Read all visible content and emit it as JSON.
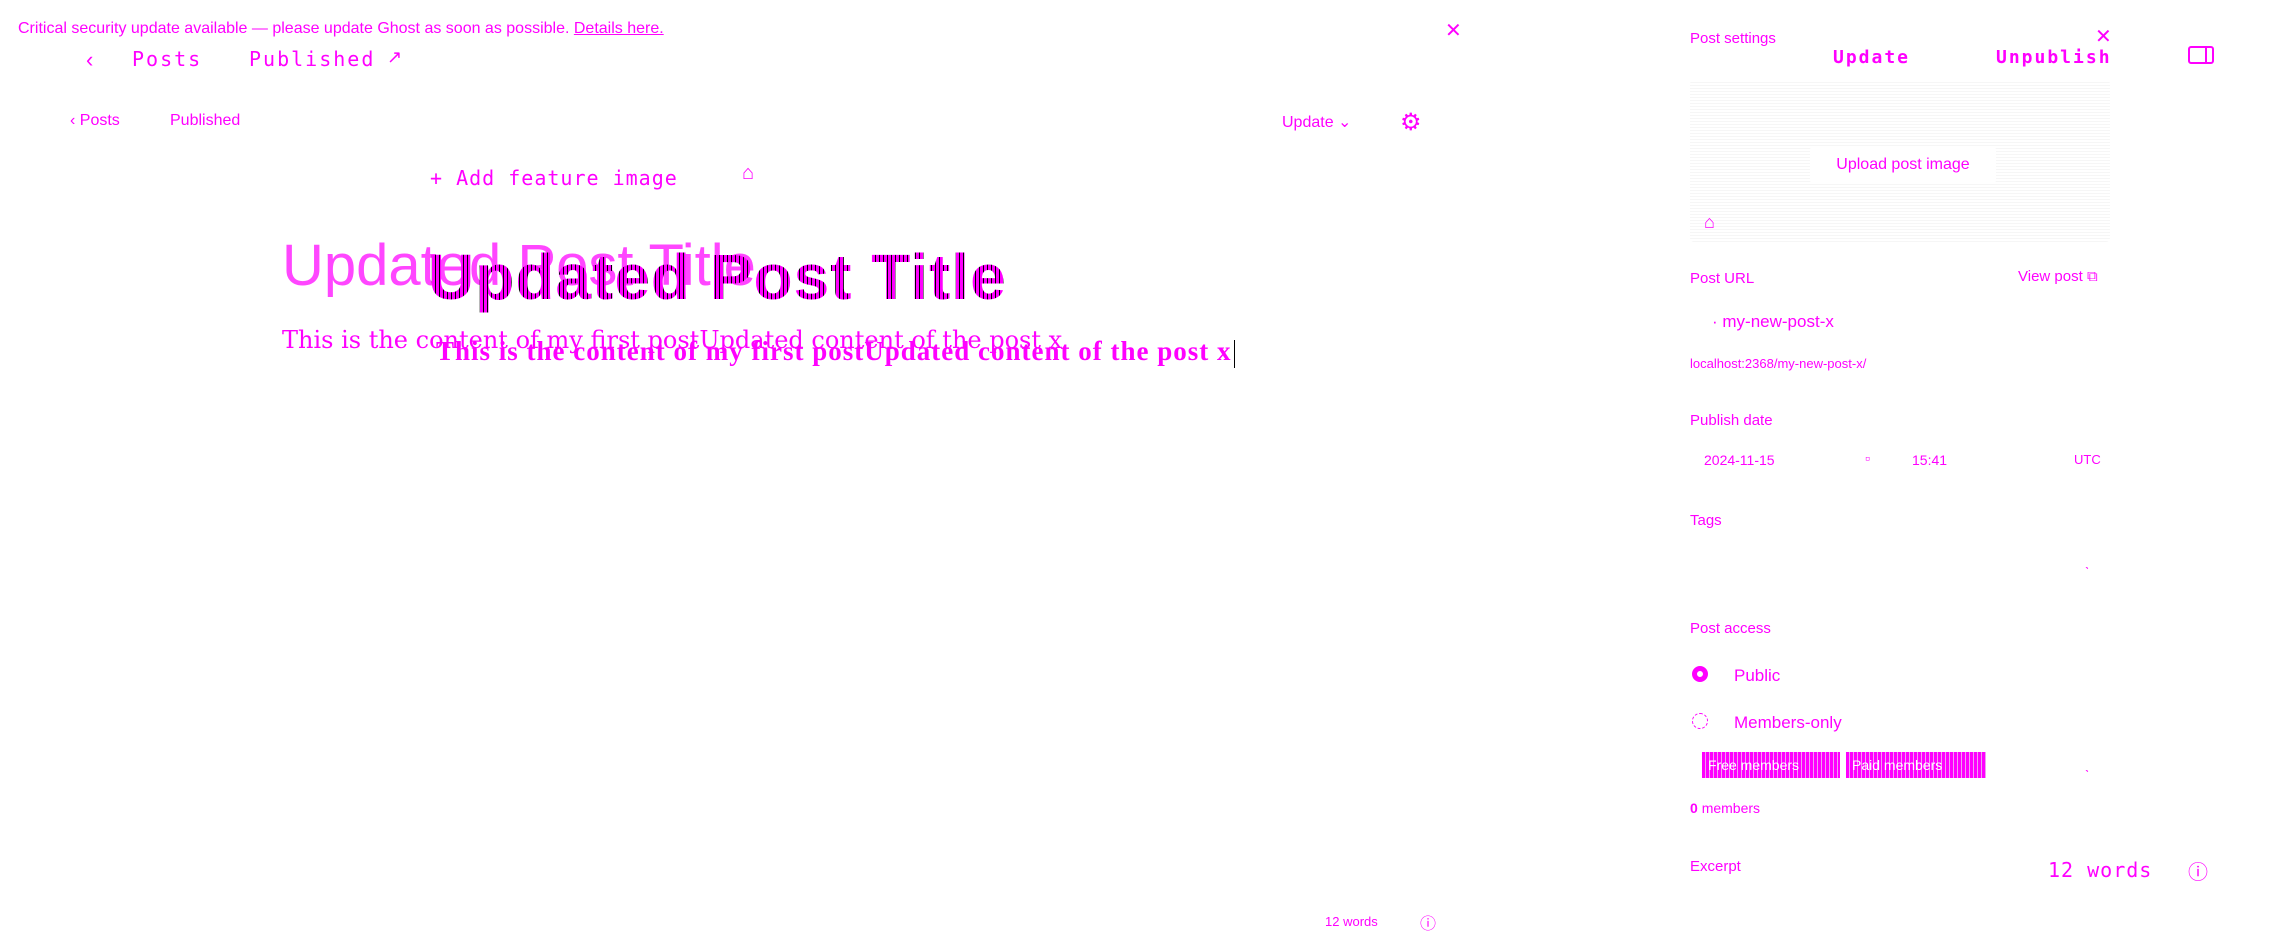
{
  "banner": {
    "message": "Critical security update available — please update Ghost as soon as possible.",
    "link": "Details here.",
    "close_icon": "close-icon"
  },
  "header_overlay": {
    "back_icon": "chevron-left-icon",
    "posts": "Posts",
    "published": "Published",
    "edit_icon": "pencil-icon"
  },
  "editor_header": {
    "back_label": "Posts",
    "status": "Published",
    "update_label": "Update",
    "settings_icon": "gear-icon"
  },
  "editor": {
    "add_feature_image": "+ Add feature image",
    "image_icon": "image-icon",
    "title_ghost": "Updated Post Title",
    "title": "Updated Post Title",
    "body_ghost": "This is the content of my first postUpdated content of the post x",
    "body": "This is the content of my first postUpdated content of the post x"
  },
  "footer": {
    "word_count": "12 words",
    "help_icon": "question-icon"
  },
  "settings": {
    "title": "Post settings",
    "update_label": "Update",
    "unpublish_label": "Unpublish",
    "panel_icon": "sidebar-toggle-icon",
    "upload_label": "Upload post image",
    "post_url_label": "Post URL",
    "view_post_label": "View post",
    "slug": "my-new-post-x",
    "full_url": "localhost:2368/my-new-post-x/",
    "publish_date_label": "Publish date",
    "date": "2024-11-15",
    "time": "15:41",
    "timezone": "UTC",
    "tags_label": "Tags",
    "post_access_label": "Post access",
    "public_label": "Public",
    "members_label": "Members-only",
    "chip_1": "Free members",
    "chip_2": "Paid members",
    "members_count_bold": "0",
    "members_count_rest": "members",
    "excerpt_label": "Excerpt",
    "word_count": "12 words"
  },
  "colors": {
    "accent": "#ff00ff",
    "background": "#ffffff"
  }
}
